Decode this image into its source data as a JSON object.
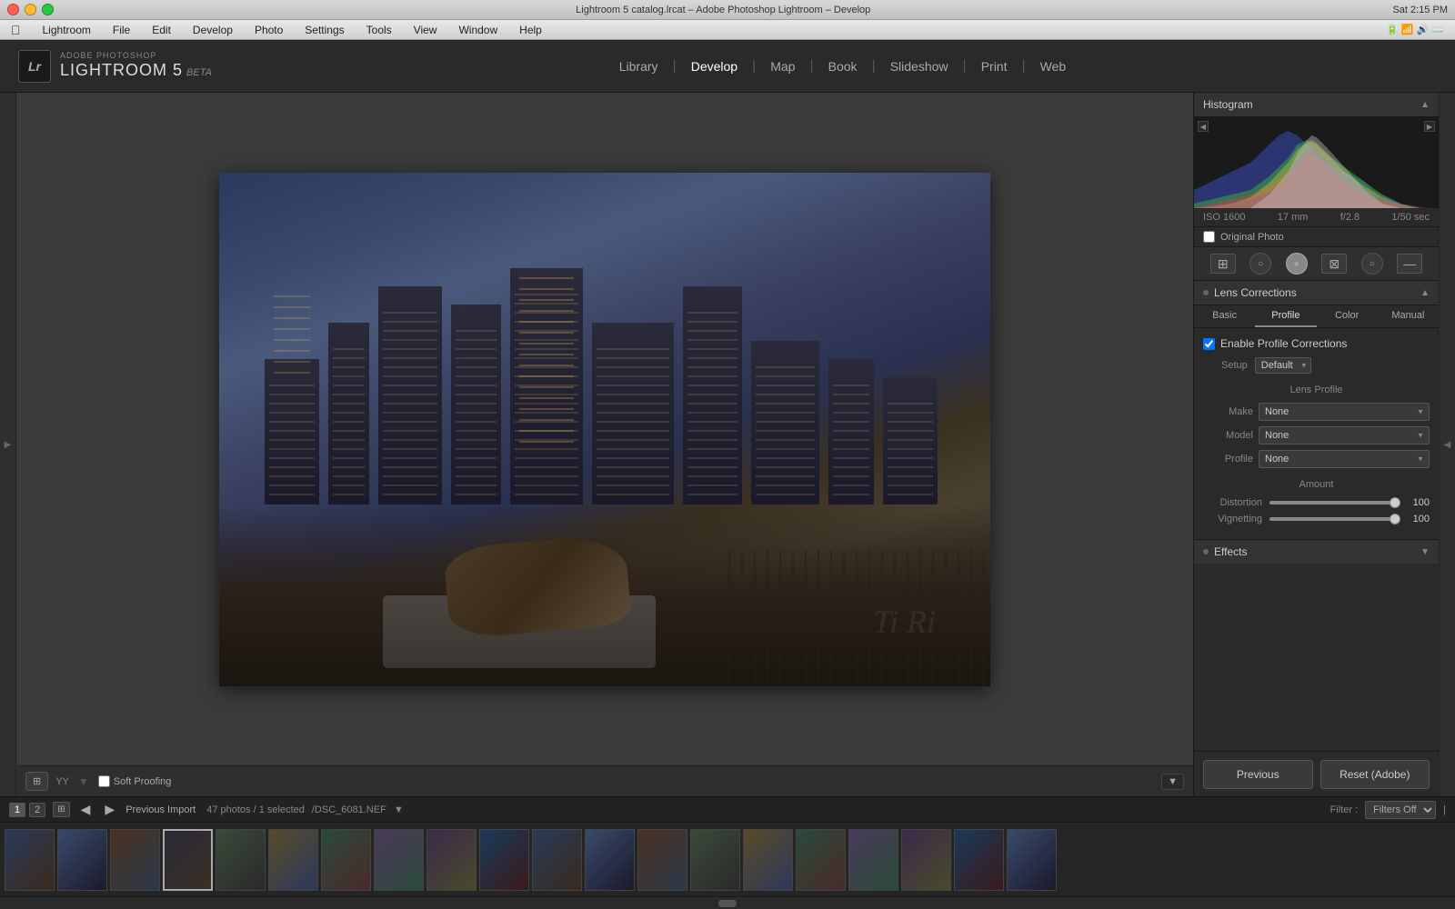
{
  "window": {
    "title": "Lightroom 5 catalog.lrcat – Adobe Photoshop Lightroom – Develop",
    "mac_menu": [
      "Apple",
      "Lightroom",
      "File",
      "Edit",
      "Develop",
      "Photo",
      "Settings",
      "Tools",
      "View",
      "Window",
      "Help"
    ],
    "time": "Sat 2:15 PM"
  },
  "header": {
    "adobe_label": "ADOBE PHOTOSHOP",
    "app_name": "LIGHTROOM 5",
    "beta_label": "BETA",
    "lr_icon": "Lr",
    "nav_items": [
      {
        "label": "Library",
        "active": false
      },
      {
        "label": "Develop",
        "active": true
      },
      {
        "label": "Map",
        "active": false
      },
      {
        "label": "Book",
        "active": false
      },
      {
        "label": "Slideshow",
        "active": false
      },
      {
        "label": "Print",
        "active": false
      },
      {
        "label": "Web",
        "active": false
      }
    ]
  },
  "histogram": {
    "title": "Histogram",
    "iso": "ISO 1600",
    "focal_length": "17 mm",
    "aperture": "f/2.8",
    "shutter": "1/50 sec",
    "original_photo_label": "Original Photo"
  },
  "tools": {
    "items": [
      "⊞",
      "○",
      "●",
      "⊠",
      "○",
      "—"
    ]
  },
  "lens_corrections": {
    "title": "Lens Corrections",
    "tabs": [
      "Basic",
      "Profile",
      "Color",
      "Manual"
    ],
    "active_tab": "Profile",
    "enable_profile_label": "Enable Profile Corrections",
    "setup_label": "Setup",
    "setup_value": "Default",
    "lens_profile_title": "Lens Profile",
    "make_label": "Make",
    "make_value": "None",
    "model_label": "Model",
    "model_value": "None",
    "profile_label": "Profile",
    "profile_value": "None",
    "amount_title": "Amount",
    "distortion_label": "Distortion",
    "distortion_value": 100,
    "distortion_pct": 100,
    "vignetting_label": "Vignetting",
    "vignetting_value": 100,
    "vignetting_pct": 100
  },
  "effects": {
    "title": "Effects"
  },
  "bottom_bar": {
    "previous_label": "Previous",
    "reset_label": "Reset (Adobe)"
  },
  "toolbar": {
    "soft_proofing_label": "Soft Proofing"
  },
  "filmstrip": {
    "import_label": "Previous Import",
    "photo_count": "47 photos / 1 selected",
    "filename": "/DSC_6081.NEF",
    "filter_label": "Filter :",
    "filter_value": "Filters Off",
    "page_nums": [
      "1",
      "2"
    ]
  }
}
